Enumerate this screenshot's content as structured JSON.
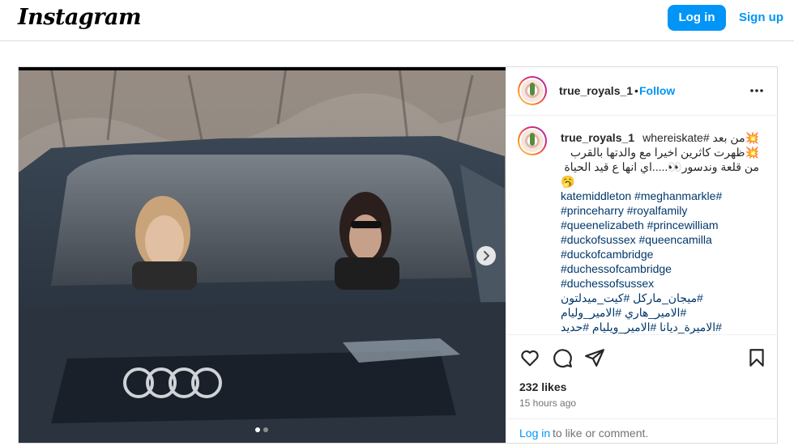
{
  "header": {
    "logo_text": "Instagram",
    "login_label": "Log in",
    "signup_label": "Sign up"
  },
  "post": {
    "username": "true_royals_1",
    "separator": "•",
    "follow_label": "Follow",
    "caption": {
      "username": "true_royals_1",
      "line1": "💥من بعد #whereiskate",
      "line2": "💥ظهرت كاثرين اخيرا مع والدتها بالقرب",
      "line3": "من قلعة وندسور👀.....اي انها ع قيد الحياة",
      "line4": "🥱",
      "hashtags": [
        "katemiddleton #meghanmarkle#",
        "#princeharry #royalfamily",
        "#queenelizabeth #princewilliam",
        "#duckofsussex #queencamilla",
        "#duckofcambridge",
        "#duchessofcambridge",
        "#duchessofsussex"
      ],
      "arabic_tags": [
        "#ميجان_ماركل #كيت_ميدلتون",
        "#الامير_هاري #الامير_وليام",
        "#الاميرة_ديانا #الامير_ويليام #حديد"
      ]
    },
    "likes": "232 likes",
    "time": "15 hours ago",
    "comment_login": "Log in",
    "comment_rest": "to like or comment.",
    "carousel": {
      "total": 2,
      "current": 1
    }
  },
  "icons": {
    "more": "more-horizontal-icon",
    "like": "heart-icon",
    "comment": "comment-icon",
    "share": "share-icon",
    "save": "bookmark-icon",
    "next": "chevron-right-icon"
  },
  "colors": {
    "accent": "#0095f6",
    "border": "#dbdbdb",
    "text": "#262626",
    "muted": "#737373",
    "hashtag": "#00376b"
  }
}
